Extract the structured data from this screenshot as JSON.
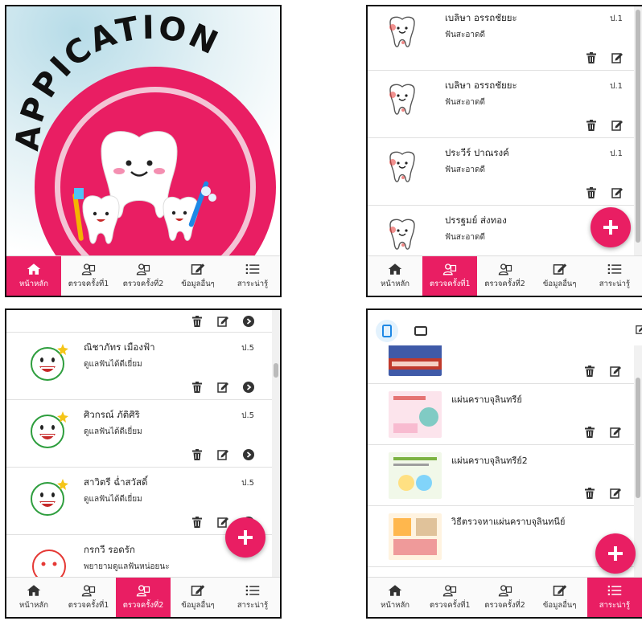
{
  "nav": {
    "home": "หน้าหลัก",
    "exam1": "ตรวจครั้งที่1",
    "exam2": "ตรวจครั้งที่2",
    "other": "ข้อมูลอื่นๆ",
    "knowledge": "สาระน่ารู้"
  },
  "splash": {
    "logo_text": "APPICATION"
  },
  "panel2": {
    "students": [
      {
        "name": "เบลิษา อรรถชัยยะ",
        "status": "ฟันสะอาดดี",
        "grade": "ป.1"
      },
      {
        "name": "เบลิษา อรรถชัยยะ",
        "status": "ฟันสะอาดดี",
        "grade": "ป.1"
      },
      {
        "name": "ประวีร์ ปาณรงค์",
        "status": "ฟันสะอาดดี",
        "grade": "ป.1"
      },
      {
        "name": "ปรรฐมย์ ส่งทอง",
        "status": "ฟันสะอาดดี",
        "grade": ""
      }
    ]
  },
  "panel3": {
    "students": [
      {
        "name": "ณิชาภัทร เมืองฟ้า",
        "status": "ดูแลฟันได้ดีเยี่ยม",
        "grade": "ป.5"
      },
      {
        "name": "ศิวกรณ์ ภัติศิริ",
        "status": "ดูแลฟันได้ดีเยี่ยม",
        "grade": "ป.5"
      },
      {
        "name": "สาวิตรี ฉ่ำสวัสดิ์",
        "status": "ดูแลฟันได้ดีเยี่ยม",
        "grade": "ป.5"
      },
      {
        "name": "กรกวี รอดรัก",
        "status": "พยายามดูแลฟันหน่อยนะ",
        "grade": ""
      }
    ]
  },
  "panel4": {
    "articles": [
      {
        "title": ""
      },
      {
        "title": "แผ่นคราบจุลินทรีย์"
      },
      {
        "title": "แผ่นคราบจุลินทรีย์2"
      },
      {
        "title": "วิธีตรวจหาแผ่นคราบจุลินทนีย์"
      }
    ]
  },
  "colors": {
    "accent": "#e91e63",
    "happy_face": "#2e9e3e",
    "sad_face": "#e53935"
  }
}
